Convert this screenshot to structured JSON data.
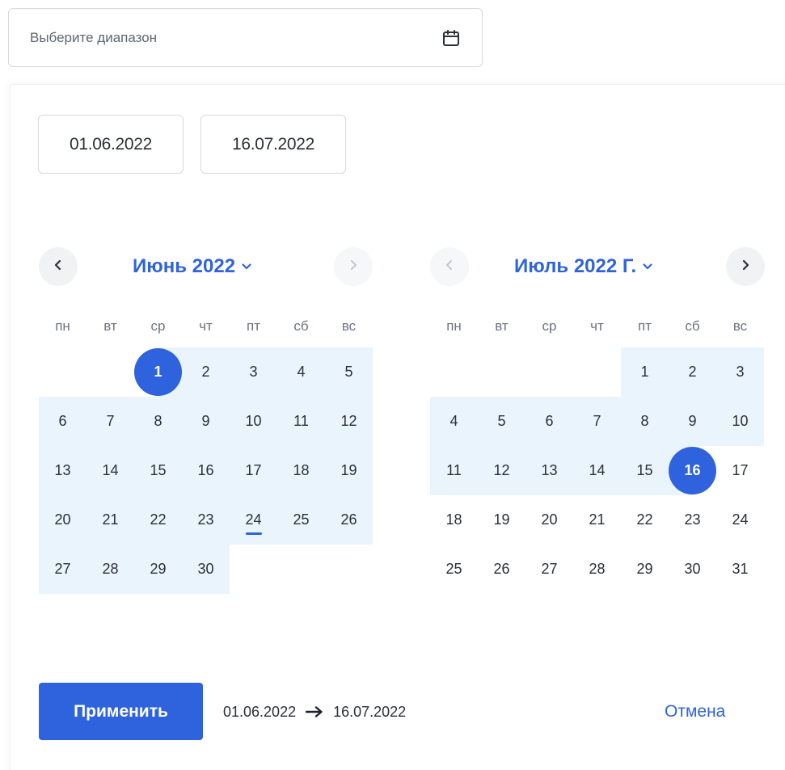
{
  "range_input": {
    "placeholder": "Выберите диапазон",
    "icon": "calendar-icon"
  },
  "fields": {
    "start": "01.06.2022",
    "end": "16.07.2022"
  },
  "left_calendar": {
    "title": "Июнь 2022",
    "weekdays": [
      "пн",
      "вт",
      "ср",
      "чт",
      "пт",
      "сб",
      "вс"
    ],
    "weeks": [
      [
        "",
        "",
        "1",
        "2",
        "3",
        "4",
        "5"
      ],
      [
        "6",
        "7",
        "8",
        "9",
        "10",
        "11",
        "12"
      ],
      [
        "13",
        "14",
        "15",
        "16",
        "17",
        "18",
        "19"
      ],
      [
        "20",
        "21",
        "22",
        "23",
        "24",
        "25",
        "26"
      ],
      [
        "27",
        "28",
        "29",
        "30",
        "",
        "",
        ""
      ]
    ]
  },
  "right_calendar": {
    "title": "Июль 2022 Г.",
    "weekdays": [
      "пн",
      "вт",
      "ср",
      "чт",
      "пт",
      "сб",
      "вс"
    ],
    "weeks": [
      [
        "",
        "",
        "",
        "",
        "1",
        "2",
        "3"
      ],
      [
        "4",
        "5",
        "6",
        "7",
        "8",
        "9",
        "10"
      ],
      [
        "11",
        "12",
        "13",
        "14",
        "15",
        "16",
        "17"
      ],
      [
        "18",
        "19",
        "20",
        "21",
        "22",
        "23",
        "24"
      ],
      [
        "25",
        "26",
        "27",
        "28",
        "29",
        "30",
        "31"
      ]
    ]
  },
  "footer": {
    "apply_label": "Применить",
    "summary_start": "01.06.2022",
    "summary_end": "16.07.2022",
    "cancel_label": "Отмена"
  },
  "colors": {
    "accent": "#2f63dd",
    "range_fill": "#e9f4fd",
    "border": "#d6d9de"
  }
}
